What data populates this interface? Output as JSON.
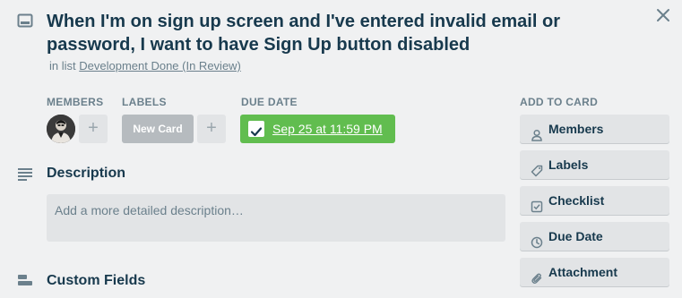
{
  "card": {
    "title": "When I'm on sign up screen and I've entered invalid email or password, I want to have Sign Up button disabled",
    "in_list_prefix": "in list",
    "list_name": "Development Done (In Review)"
  },
  "members": {
    "label": "MEMBERS",
    "add": "+"
  },
  "labels": {
    "label": "LABELS",
    "chip": "New Card",
    "add": "+"
  },
  "due_date": {
    "label": "DUE DATE",
    "value": "Sep 25 at 11:59 PM",
    "completed": true
  },
  "description": {
    "heading": "Description",
    "placeholder": "Add a more detailed description…"
  },
  "custom_fields": {
    "heading": "Custom Fields"
  },
  "add_to_card": {
    "label": "ADD TO CARD",
    "items": [
      {
        "label": "Members",
        "icon": "person-icon"
      },
      {
        "label": "Labels",
        "icon": "tag-icon"
      },
      {
        "label": "Checklist",
        "icon": "checkbox-icon"
      },
      {
        "label": "Due Date",
        "icon": "clock-icon"
      },
      {
        "label": "Attachment",
        "icon": "paperclip-icon"
      }
    ]
  },
  "colors": {
    "due_complete": "#61bd4f",
    "label_chip": "#b6bbbf",
    "text_primary": "#17394d",
    "text_muted": "#6b808c",
    "button_bg": "#e2e4e6",
    "background": "#f0f1f2"
  }
}
